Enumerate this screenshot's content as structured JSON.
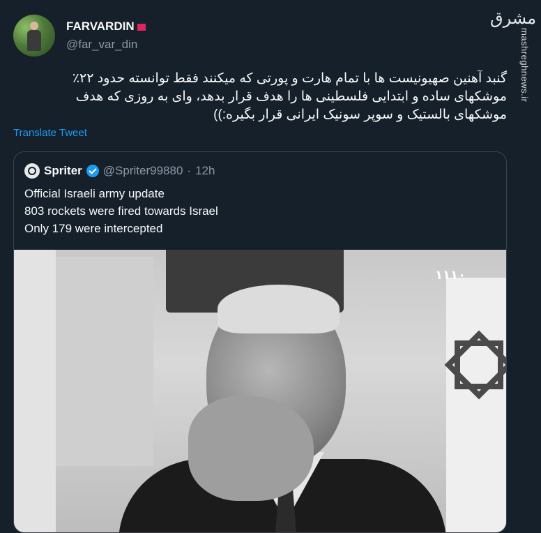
{
  "author": {
    "display_name": "FARVARDIN",
    "handle": "@far_var_din"
  },
  "watermark": {
    "logo": "مشرق",
    "site": "mashreghnews.ir"
  },
  "tweet": {
    "text": "گنبد آهنین صهیونیست ها با تمام هارت و پورتی که میکنند فقط توانسته حدود ۲۲٪\nموشکهای ساده و ابتدایی فلسطینی ها را هدف قرار بدهد، وای به روزی که هدف\nموشکهای بالستیک و سوپر سونیک ایرانی قرار بگیره:))",
    "translate_label": "Translate Tweet"
  },
  "quoted": {
    "name": "Spriter",
    "handle": "@Spriter99880",
    "separator": "·",
    "time": "12h",
    "lines": [
      "Official Israeli army update",
      "803 rockets were fired towards Israel",
      "Only 179 were intercepted"
    ],
    "image_logo": "۱۱۱۰"
  },
  "colors": {
    "background": "#15202b",
    "link": "#1d9bf0",
    "muted": "#8b98a5",
    "border": "#38444d"
  }
}
